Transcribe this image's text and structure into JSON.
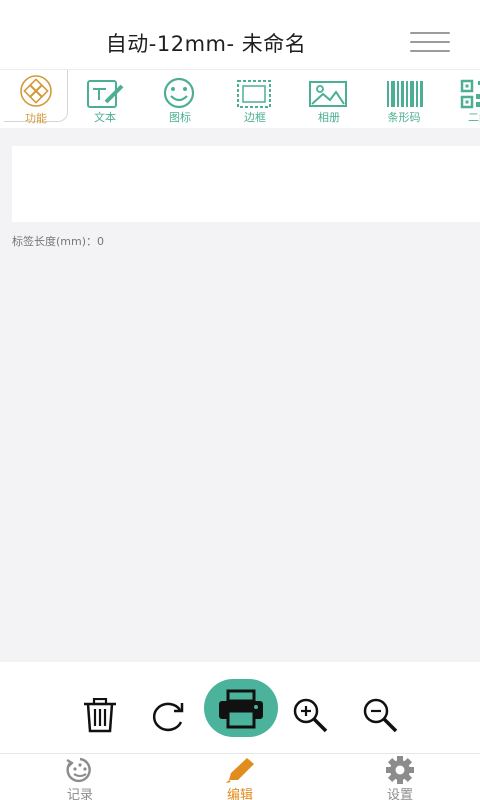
{
  "header": {
    "title": "自动-12mm- 未命名",
    "menu_icon": "hamburger-menu-icon"
  },
  "toolbar": {
    "items": [
      {
        "label": "功能",
        "icon": "function-icon"
      },
      {
        "label": "文本",
        "icon": "text-edit-icon"
      },
      {
        "label": "图标",
        "icon": "smiley-icon"
      },
      {
        "label": "边框",
        "icon": "border-frame-icon"
      },
      {
        "label": "相册",
        "icon": "photo-album-icon"
      },
      {
        "label": "条形码",
        "icon": "barcode-icon"
      },
      {
        "label": "二维",
        "icon": "qr-code-icon"
      }
    ]
  },
  "canvas": {
    "length_text": "标签长度(mm)：0"
  },
  "actions": {
    "items": [
      "trash-icon",
      "rotate-icon",
      "printer-icon",
      "zoom-in-icon",
      "zoom-out-icon"
    ]
  },
  "tabbar": {
    "items": [
      {
        "label": "记录",
        "icon": "record-icon"
      },
      {
        "label": "编辑",
        "icon": "pencil-icon"
      },
      {
        "label": "设置",
        "icon": "settings-gear-icon"
      }
    ],
    "active_index": 1
  },
  "colors": {
    "accent_green": "#4bb39b",
    "accent_orange": "#e38c1e",
    "canvas_bg": "#f3f2f5"
  }
}
